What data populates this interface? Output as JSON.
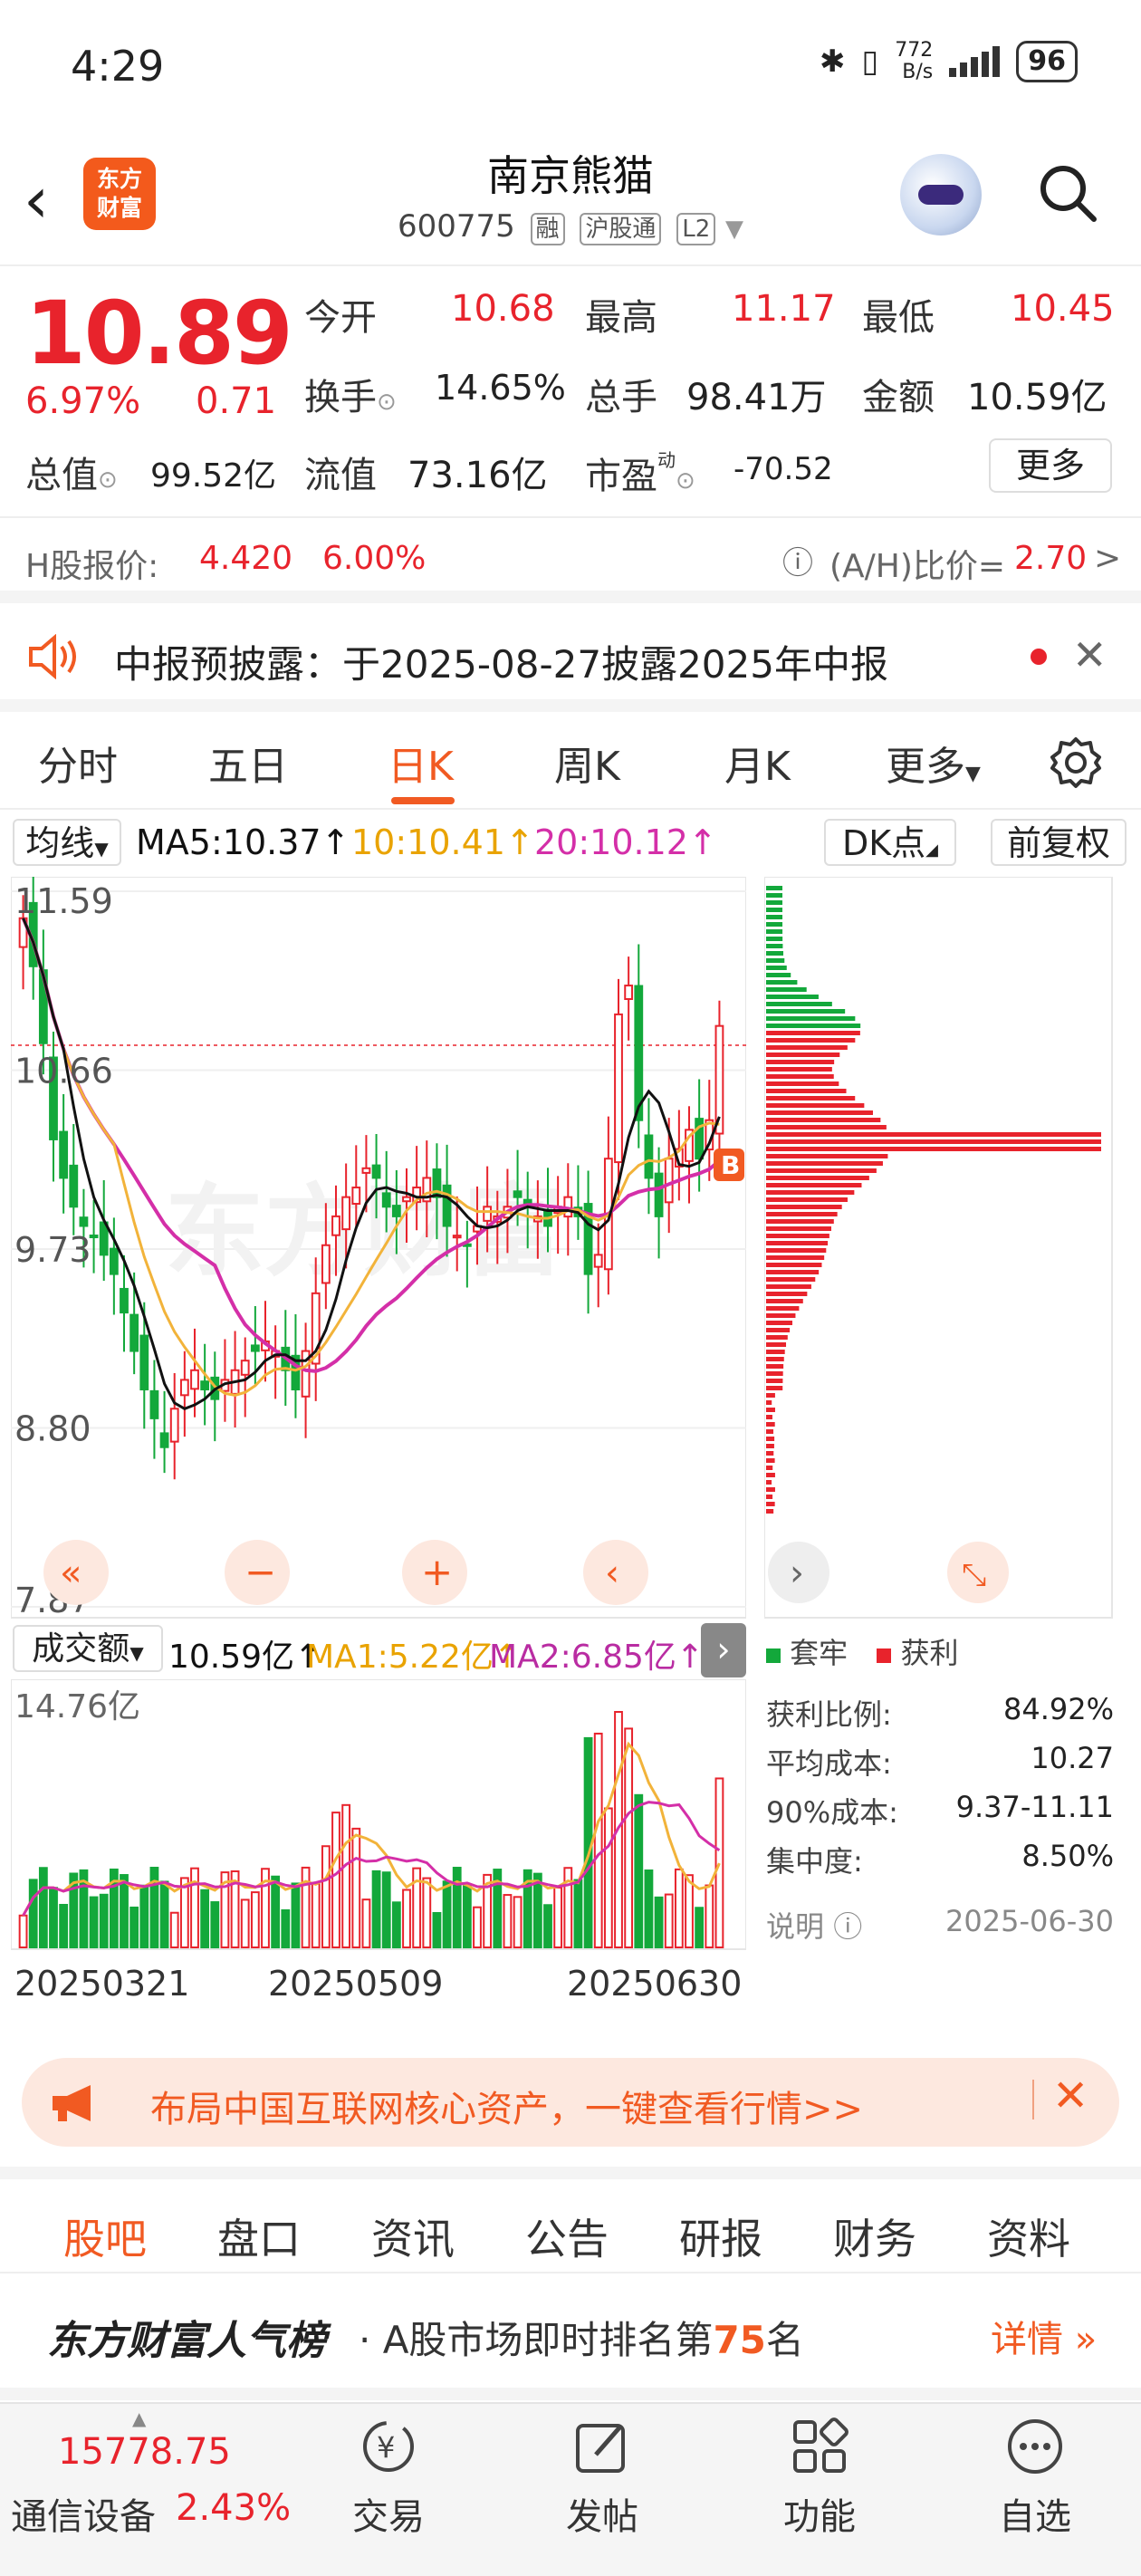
{
  "status": {
    "time": "4:29",
    "net_speed": "772",
    "net_unit": "B/s",
    "battery": "96"
  },
  "header": {
    "logo_line1": "东方",
    "logo_line2": "财富",
    "title": "南京熊猫",
    "code": "600775",
    "tags": [
      "融",
      "沪股通",
      "L2"
    ]
  },
  "quote": {
    "price": "10.89",
    "pct": "6.97%",
    "change": "0.71",
    "fields": [
      {
        "label": "今开",
        "value": "10.68",
        "color": "red"
      },
      {
        "label": "最高",
        "value": "11.17",
        "color": "red"
      },
      {
        "label": "最低",
        "value": "10.45",
        "color": "green"
      },
      {
        "label": "换手",
        "value": "14.65%",
        "color": "dark"
      },
      {
        "label": "总手",
        "value": "98.41万",
        "color": "dark"
      },
      {
        "label": "金额",
        "value": "10.59亿",
        "color": "dark"
      },
      {
        "label": "总值",
        "value": "99.52亿",
        "color": "dark"
      },
      {
        "label": "流值",
        "value": "73.16亿",
        "color": "dark"
      },
      {
        "label": "市盈",
        "sup": "动",
        "value": "-70.52",
        "color": "dark"
      }
    ],
    "more_label": "更多"
  },
  "hshare": {
    "label": "H股报价:",
    "price": "4.420",
    "pct": "6.00%",
    "ratio_label": "(A/H)比价=",
    "ratio": "2.70",
    "arrow": ">"
  },
  "notice": {
    "text": "中报预披露：于2025-08-27披露2025年中报"
  },
  "tabs": [
    "分时",
    "五日",
    "日K",
    "周K",
    "月K",
    "更多"
  ],
  "ma_legend": {
    "selector": "均线",
    "ma5": "MA5:10.37",
    "ma10": "10:10.41",
    "ma20": "20:10.12",
    "dk_label": "DK点",
    "adjust_label": "前复权"
  },
  "kchart": {
    "y_labels": [
      "11.59",
      "10.66",
      "9.73",
      "8.80",
      "7.87"
    ],
    "watermark": "东方财富",
    "badge": "B",
    "ylim": [
      7.87,
      11.59
    ]
  },
  "vol_legend": {
    "selector": "成交额",
    "current": "10.59亿",
    "ma1": "MA1:5.22亿",
    "ma2": "MA2:6.85亿"
  },
  "vol_chart": {
    "max_label": "14.76亿"
  },
  "dates": [
    "20250321",
    "20250509",
    "20250630"
  ],
  "chip": {
    "legend_trap": "套牢",
    "legend_profit": "获利",
    "rows": [
      {
        "label": "获利比例:",
        "value": "84.92%"
      },
      {
        "label": "平均成本:",
        "value": "10.27"
      },
      {
        "label": "90%成本:",
        "value": "9.37-11.11"
      },
      {
        "label": "集中度:",
        "value": "8.50%"
      }
    ],
    "note_label": "说明",
    "date": "2025-06-30"
  },
  "ad": {
    "text": "布局中国互联网核心资产，一键查看行情>>"
  },
  "bottom_tabs": [
    "股吧",
    "盘口",
    "资讯",
    "公告",
    "研报",
    "财务",
    "资料"
  ],
  "rank": {
    "brand": "东方财富人气榜",
    "text_before": "· A股市场即时排名第",
    "rank": "75",
    "text_after": "名",
    "detail": "详情"
  },
  "nav": {
    "index_value": "15778.75",
    "index_name": "通信设备",
    "index_pct": "2.43%",
    "items": [
      "交易",
      "发帖",
      "功能",
      "自选"
    ]
  },
  "colors": {
    "up": "#e8232c",
    "down": "#13a83b",
    "accent": "#f15a22",
    "ma5": "#111111",
    "ma10": "#f2b33a",
    "ma20": "#d42fa8"
  }
}
